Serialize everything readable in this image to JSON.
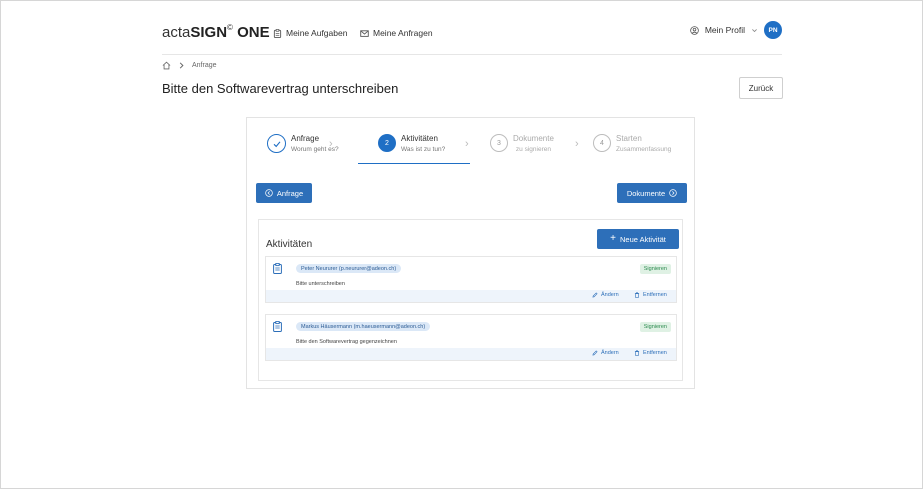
{
  "header": {
    "brand_prefix": "acta",
    "brand_main": "SIGN",
    "brand_mark": "©",
    "brand_suffix": "ONE",
    "nav": [
      {
        "label": "Meine Aufgaben",
        "icon": "clipboard-icon"
      },
      {
        "label": "Meine Anfragen",
        "icon": "envelope-icon"
      }
    ],
    "profile_label": "Mein Profil",
    "avatar_initials": "PN"
  },
  "breadcrumb": {
    "home_icon": "home-icon",
    "current": "Anfrage"
  },
  "page": {
    "title": "Bitte den Softwarevertrag unterschreiben",
    "back_label": "Zurück"
  },
  "stepper": [
    {
      "number": "",
      "title": "Anfrage",
      "subtitle": "Worum geht es?",
      "state": "done"
    },
    {
      "number": "2",
      "title": "Aktivitäten",
      "subtitle": "Was ist zu tun?",
      "state": "active"
    },
    {
      "number": "3",
      "title": "Dokumente",
      "subtitle": "zu signieren",
      "state": "inactive"
    },
    {
      "number": "4",
      "title": "Starten",
      "subtitle": "Zusammenfassung",
      "state": "inactive"
    }
  ],
  "nav_buttons": {
    "prev_label": "Anfrage",
    "next_label": "Dokumente"
  },
  "activities": {
    "title": "Aktivitäten",
    "add_label": "Neue Aktivität",
    "items": [
      {
        "person": "Peter Neururer (p.neururer@adeon.ch)",
        "description": "Bitte unterschreiben",
        "badge": "Signieren",
        "edit_label": "Ändern",
        "delete_label": "Entfernen"
      },
      {
        "person": "Markus Häusermann (m.haeusermann@adeon.ch)",
        "description": "Bitte den Softwarevertrag gegenzeichnen",
        "badge": "Signieren",
        "edit_label": "Ändern",
        "delete_label": "Entfernen"
      }
    ]
  },
  "colors": {
    "accent": "#2d6fb9",
    "badge_bg": "#dff1e4",
    "badge_text": "#2b8a4e"
  }
}
